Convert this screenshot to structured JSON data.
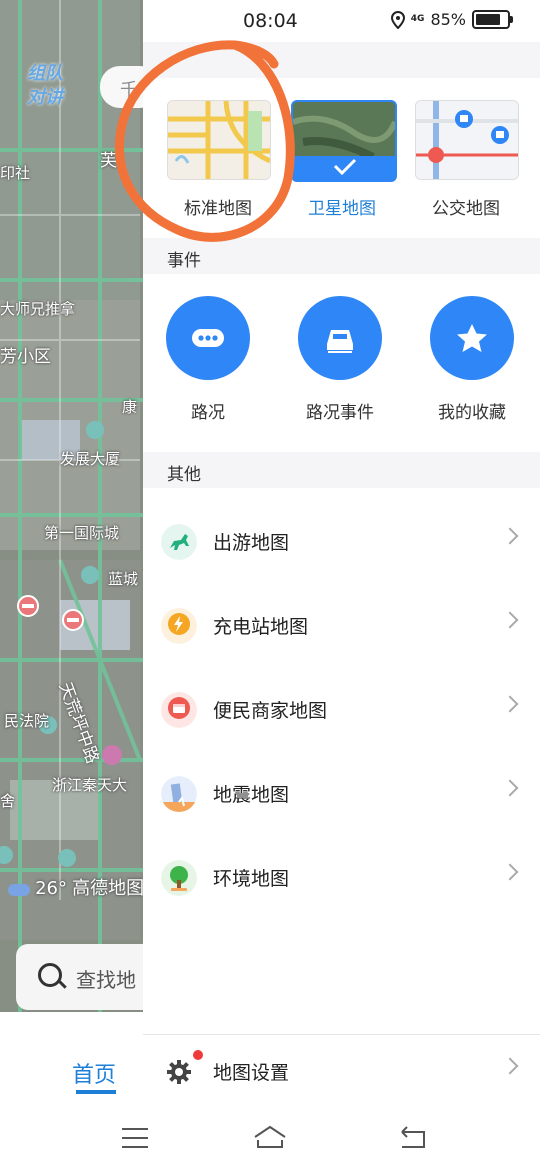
{
  "status_bar": {
    "time": "08:04",
    "network": "4G",
    "battery": "85%"
  },
  "map": {
    "team_button": "组队\n对讲",
    "labels": [
      "印社",
      "芙",
      "大师兄推拿",
      "芳小区",
      "康",
      "发展大厦",
      "第一国际城",
      "蓝城",
      "天荒坪中路",
      "民法院",
      "浙江秦天大",
      "舍"
    ],
    "weather_temp": "26°",
    "weather_label": "高德地图",
    "search_placeholder": "查找地",
    "top_chip": "千",
    "home_tab": "首页"
  },
  "panel": {
    "section_map_type": "",
    "map_types": [
      {
        "label": "标准地图",
        "active": false
      },
      {
        "label": "卫星地图",
        "active": true
      },
      {
        "label": "公交地图",
        "active": false
      }
    ],
    "section_events": "事件",
    "events": [
      {
        "label": "路况",
        "icon": "more-icon"
      },
      {
        "label": "路况事件",
        "icon": "road-event-icon"
      },
      {
        "label": "我的收藏",
        "icon": "star-icon"
      }
    ],
    "section_other": "其他",
    "other_items": [
      {
        "label": "出游地图",
        "icon": "horse-icon",
        "color": "#22b07d"
      },
      {
        "label": "充电站地图",
        "icon": "lightning-icon",
        "color": "#f5a623"
      },
      {
        "label": "便民商家地图",
        "icon": "shop-icon",
        "color": "#ee5a52"
      },
      {
        "label": "地震地图",
        "icon": "earthquake-icon",
        "color": "#3f7fd9"
      },
      {
        "label": "环境地图",
        "icon": "tree-icon",
        "color": "#3db34a"
      }
    ],
    "settings_label": "地图设置"
  },
  "colors": {
    "accent": "#1e7fd8",
    "circle_blue": "#2f86f6",
    "annotation": "#f2733a"
  }
}
